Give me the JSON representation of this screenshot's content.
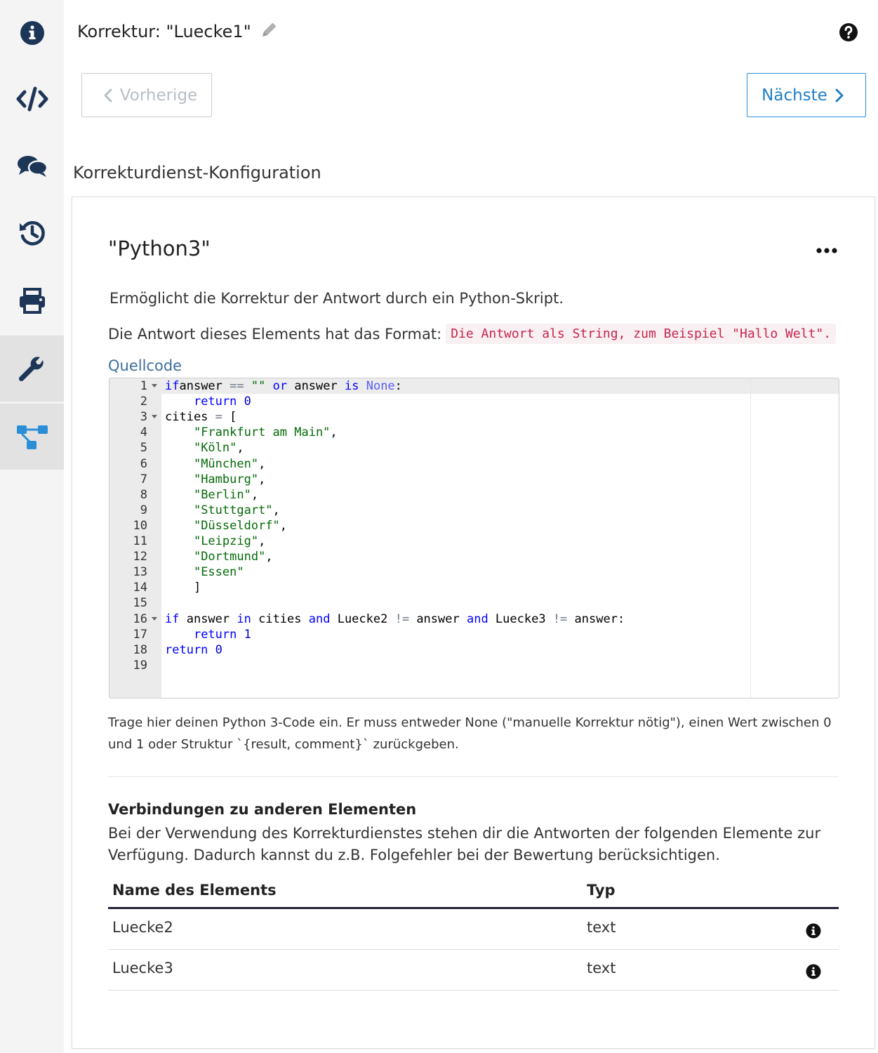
{
  "sidebar": {
    "items": [
      {
        "icon": "info-icon"
      },
      {
        "icon": "code-icon"
      },
      {
        "icon": "comments-icon"
      },
      {
        "icon": "history-icon"
      },
      {
        "icon": "print-icon"
      },
      {
        "icon": "wrench-icon"
      },
      {
        "icon": "sitemap-icon"
      }
    ],
    "active_color": "#e2e2e2",
    "icon_color": "#1d3557",
    "accent": "#2a8fd6"
  },
  "header": {
    "title": "Korrektur: \"Luecke1\"",
    "help_icon": "question-circle-icon",
    "edit_icon": "pencil-icon"
  },
  "nav": {
    "prev_label": "Vorherige",
    "next_label": "Nächste"
  },
  "section_title": "Korrekturdienst-Konfiguration",
  "card": {
    "title": "\"Python3\"",
    "menu_icon": "ellipsis-icon",
    "description": "Ermöglicht die Korrektur der Antwort durch ein Python-Skript.",
    "format_label": "Die Antwort dieses Elements hat das Format:",
    "format_value": "Die Antwort als String, zum Beispiel \"Hallo Welt\".",
    "code_label": "Quellcode",
    "help_text": "Trage hier deinen Python 3-Code ein. Er muss entweder None (\"manuelle Korrektur nötig\"), einen Wert zwischen 0 und 1 oder Struktur `{result, comment}` zurückgeben.",
    "connections_title": "Verbindungen zu anderen Elementen",
    "connections_desc": "Bei der Verwendung des Korrekturdienstes stehen dir die Antworten der folgenden Elemente zur Verfügung. Dadurch kannst du z.B. Folgefehler bei der Bewertung berücksichtigen.",
    "table": {
      "headers": [
        "Name des Elements",
        "Typ"
      ],
      "rows": [
        {
          "name": "Luecke2",
          "type": "text"
        },
        {
          "name": "Luecke3",
          "type": "text"
        }
      ]
    }
  },
  "code_lines": [
    {
      "n": "1",
      "fold": true,
      "tokens": [
        [
          "kw",
          "if"
        ],
        [
          "",
          "answer "
        ],
        [
          "op",
          "=="
        ],
        [
          "",
          " "
        ],
        [
          "str",
          "\"\""
        ],
        [
          "",
          " "
        ],
        [
          "kw",
          "or"
        ],
        [
          "",
          " answer "
        ],
        [
          "kw",
          "is"
        ],
        [
          "",
          " "
        ],
        [
          "cn",
          "None"
        ],
        [
          "",
          ":"
        ]
      ]
    },
    {
      "n": "2",
      "fold": false,
      "tokens": [
        [
          "",
          "    "
        ],
        [
          "kw",
          "return"
        ],
        [
          "",
          " "
        ],
        [
          "num",
          "0"
        ]
      ]
    },
    {
      "n": "3",
      "fold": true,
      "tokens": [
        [
          "",
          "cities "
        ],
        [
          "op",
          "="
        ],
        [
          "",
          " ["
        ]
      ]
    },
    {
      "n": "4",
      "fold": false,
      "tokens": [
        [
          "",
          "    "
        ],
        [
          "str",
          "\"Frankfurt am Main\""
        ],
        [
          "",
          ","
        ]
      ]
    },
    {
      "n": "5",
      "fold": false,
      "tokens": [
        [
          "",
          "    "
        ],
        [
          "str",
          "\"Köln\""
        ],
        [
          "",
          ","
        ]
      ]
    },
    {
      "n": "6",
      "fold": false,
      "tokens": [
        [
          "",
          "    "
        ],
        [
          "str",
          "\"München\""
        ],
        [
          "",
          ","
        ]
      ]
    },
    {
      "n": "7",
      "fold": false,
      "tokens": [
        [
          "",
          "    "
        ],
        [
          "str",
          "\"Hamburg\""
        ],
        [
          "",
          ","
        ]
      ]
    },
    {
      "n": "8",
      "fold": false,
      "tokens": [
        [
          "",
          "    "
        ],
        [
          "str",
          "\"Berlin\""
        ],
        [
          "",
          ","
        ]
      ]
    },
    {
      "n": "9",
      "fold": false,
      "tokens": [
        [
          "",
          "    "
        ],
        [
          "str",
          "\"Stuttgart\""
        ],
        [
          "",
          ","
        ]
      ]
    },
    {
      "n": "10",
      "fold": false,
      "tokens": [
        [
          "",
          "    "
        ],
        [
          "str",
          "\"Düsseldorf\""
        ],
        [
          "",
          ","
        ]
      ]
    },
    {
      "n": "11",
      "fold": false,
      "tokens": [
        [
          "",
          "    "
        ],
        [
          "str",
          "\"Leipzig\""
        ],
        [
          "",
          ","
        ]
      ]
    },
    {
      "n": "12",
      "fold": false,
      "tokens": [
        [
          "",
          "    "
        ],
        [
          "str",
          "\"Dortmund\""
        ],
        [
          "",
          ","
        ]
      ]
    },
    {
      "n": "13",
      "fold": false,
      "tokens": [
        [
          "",
          "    "
        ],
        [
          "str",
          "\"Essen\""
        ]
      ]
    },
    {
      "n": "14",
      "fold": false,
      "tokens": [
        [
          "",
          "    ]"
        ]
      ]
    },
    {
      "n": "15",
      "fold": false,
      "tokens": []
    },
    {
      "n": "16",
      "fold": true,
      "tokens": [
        [
          "kw",
          "if"
        ],
        [
          "",
          " answer "
        ],
        [
          "kw",
          "in"
        ],
        [
          "",
          " cities "
        ],
        [
          "kw",
          "and"
        ],
        [
          "",
          " Luecke2 "
        ],
        [
          "op",
          "!="
        ],
        [
          "",
          " answer "
        ],
        [
          "kw",
          "and"
        ],
        [
          "",
          " Luecke3 "
        ],
        [
          "op",
          "!="
        ],
        [
          "",
          " answer:"
        ]
      ]
    },
    {
      "n": "17",
      "fold": false,
      "tokens": [
        [
          "",
          "    "
        ],
        [
          "kw",
          "return"
        ],
        [
          "",
          " "
        ],
        [
          "num",
          "1"
        ]
      ]
    },
    {
      "n": "18",
      "fold": false,
      "tokens": [
        [
          "kw",
          "return"
        ],
        [
          "",
          " "
        ],
        [
          "num",
          "0"
        ]
      ]
    },
    {
      "n": "19",
      "fold": false,
      "tokens": []
    }
  ]
}
